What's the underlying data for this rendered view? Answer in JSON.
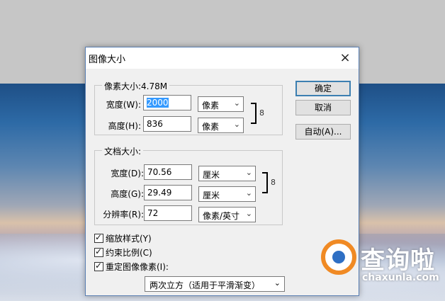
{
  "dialog": {
    "title": "图像大小",
    "close_icon": "×"
  },
  "pixel_dimensions": {
    "legend": "像素大小:4.78M",
    "width_label": "宽度(W):",
    "width_value": "2000",
    "width_unit": "像素",
    "height_label": "高度(H):",
    "height_value": "836",
    "height_unit": "像素"
  },
  "document_size": {
    "legend": "文档大小:",
    "width_label": "宽度(D):",
    "width_value": "70.56",
    "width_unit": "厘米",
    "height_label": "高度(G):",
    "height_value": "29.49",
    "height_unit": "厘米",
    "resolution_label": "分辨率(R):",
    "resolution_value": "72",
    "resolution_unit": "像素/英寸"
  },
  "buttons": {
    "ok": "确定",
    "cancel": "取消",
    "auto": "自动(A)..."
  },
  "options": {
    "scale_styles": "缩放样式(Y)",
    "constrain_proportions": "约束比例(C)",
    "resample_image": "重定图像像素(I):",
    "resample_method": "两次立方（适用于平滑渐变）"
  },
  "watermark": {
    "brand": "查询啦",
    "url": "chaxunla.com"
  },
  "icons": {
    "close": "close-icon",
    "chevron": "chevron-down-icon",
    "link": "chain-link-icon",
    "checkbox": "checkmark-icon"
  }
}
